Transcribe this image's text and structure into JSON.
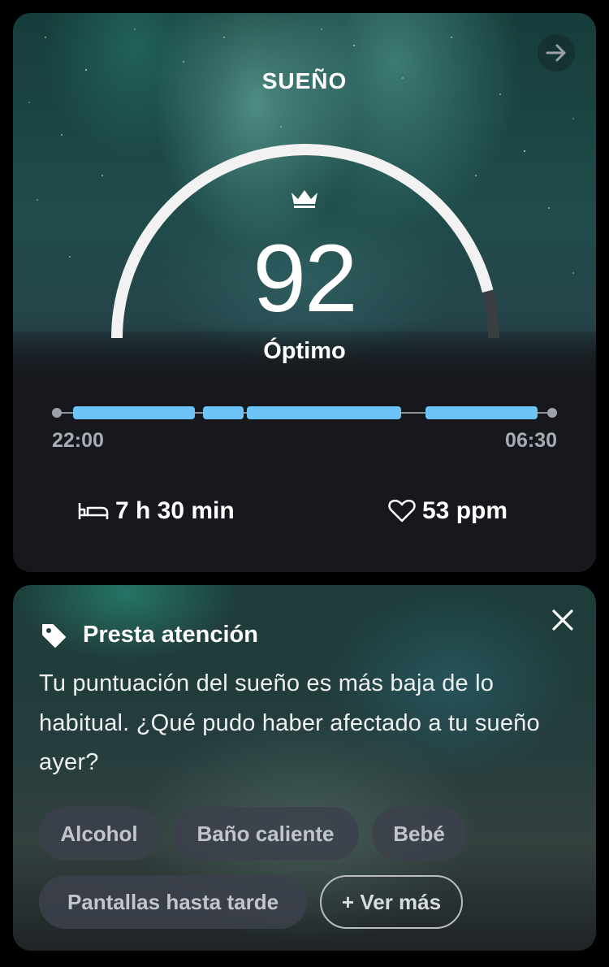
{
  "sleep_card": {
    "title": "SUEÑO",
    "score": "92",
    "quality": "Óptimo",
    "score_fraction": 0.92,
    "time_start": "22:00",
    "time_end": "06:30",
    "duration": "7 h 30 min",
    "heart_rate": "53 ppm",
    "icons": [
      "arrow-right-icon",
      "crown-icon",
      "bed-icon",
      "heart-icon"
    ],
    "colors": {
      "sleep_segment": "#6cc3f5",
      "gauge_fill": "#f2f2f2",
      "gauge_track": "#3a3d42"
    }
  },
  "alert_card": {
    "title": "Presta atención",
    "message": "Tu puntuación del sueño es más baja de lo habitual. ¿Qué pudo haber afectado a tu sueño ayer?",
    "chips": [
      "Alcohol",
      "Baño caliente",
      "Bebé",
      "Pantallas hasta tarde"
    ],
    "more_label": "+ Ver más",
    "icons": [
      "tag-icon",
      "close-icon"
    ]
  }
}
